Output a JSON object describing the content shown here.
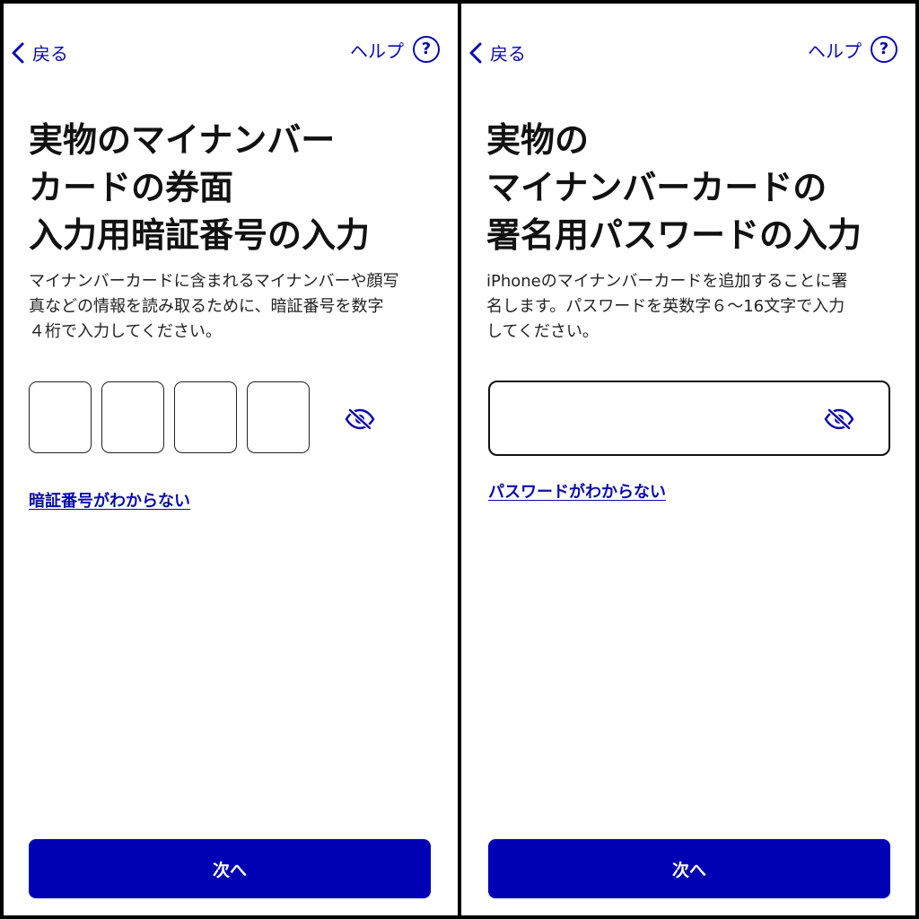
{
  "colors": {
    "accent": "#0000b4",
    "link": "#0a0ab0",
    "text": "#111111"
  },
  "left_screen": {
    "back_label": "戻る",
    "help_label": "ヘルプ",
    "help_icon_glyph": "?",
    "title": "実物のマイナンバー\nカードの券面\n入力用暗証番号の入力",
    "description": "マイナンバーカードに含まれるマイナンバーや顔写\n真などの情報を読み取るために、暗証番号を数字\n４桁で入力してください。",
    "pin_digits": [
      "",
      "",
      "",
      ""
    ],
    "visibility_icon": "eye-slash-icon",
    "forgot_link": "暗証番号がわからない",
    "next_button": "次へ"
  },
  "right_screen": {
    "back_label": "戻る",
    "help_label": "ヘルプ",
    "help_icon_glyph": "?",
    "title": "実物の\nマイナンバーカードの\n署名用パスワードの入力",
    "description": "iPhoneのマイナンバーカードを追加することに署\n名します。パスワードを英数字６～16文字で入力\nしてください。",
    "password_value": "",
    "visibility_icon": "eye-slash-icon",
    "forgot_link": "パスワードがわからない",
    "next_button": "次へ"
  }
}
